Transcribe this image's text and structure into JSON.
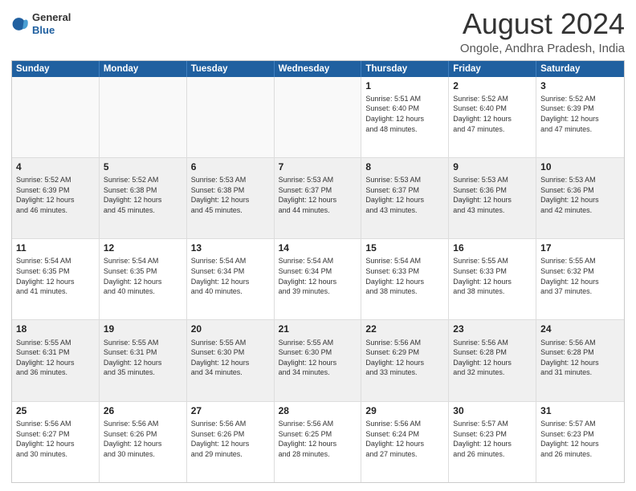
{
  "header": {
    "logo_general": "General",
    "logo_blue": "Blue",
    "month": "August 2024",
    "location": "Ongole, Andhra Pradesh, India"
  },
  "weekdays": [
    "Sunday",
    "Monday",
    "Tuesday",
    "Wednesday",
    "Thursday",
    "Friday",
    "Saturday"
  ],
  "rows": [
    [
      {
        "day": "",
        "info": "",
        "empty": true
      },
      {
        "day": "",
        "info": "",
        "empty": true
      },
      {
        "day": "",
        "info": "",
        "empty": true
      },
      {
        "day": "",
        "info": "",
        "empty": true
      },
      {
        "day": "1",
        "info": "Sunrise: 5:51 AM\nSunset: 6:40 PM\nDaylight: 12 hours\nand 48 minutes.",
        "empty": false
      },
      {
        "day": "2",
        "info": "Sunrise: 5:52 AM\nSunset: 6:40 PM\nDaylight: 12 hours\nand 47 minutes.",
        "empty": false
      },
      {
        "day": "3",
        "info": "Sunrise: 5:52 AM\nSunset: 6:39 PM\nDaylight: 12 hours\nand 47 minutes.",
        "empty": false
      }
    ],
    [
      {
        "day": "4",
        "info": "Sunrise: 5:52 AM\nSunset: 6:39 PM\nDaylight: 12 hours\nand 46 minutes.",
        "empty": false
      },
      {
        "day": "5",
        "info": "Sunrise: 5:52 AM\nSunset: 6:38 PM\nDaylight: 12 hours\nand 45 minutes.",
        "empty": false
      },
      {
        "day": "6",
        "info": "Sunrise: 5:53 AM\nSunset: 6:38 PM\nDaylight: 12 hours\nand 45 minutes.",
        "empty": false
      },
      {
        "day": "7",
        "info": "Sunrise: 5:53 AM\nSunset: 6:37 PM\nDaylight: 12 hours\nand 44 minutes.",
        "empty": false
      },
      {
        "day": "8",
        "info": "Sunrise: 5:53 AM\nSunset: 6:37 PM\nDaylight: 12 hours\nand 43 minutes.",
        "empty": false
      },
      {
        "day": "9",
        "info": "Sunrise: 5:53 AM\nSunset: 6:36 PM\nDaylight: 12 hours\nand 43 minutes.",
        "empty": false
      },
      {
        "day": "10",
        "info": "Sunrise: 5:53 AM\nSunset: 6:36 PM\nDaylight: 12 hours\nand 42 minutes.",
        "empty": false
      }
    ],
    [
      {
        "day": "11",
        "info": "Sunrise: 5:54 AM\nSunset: 6:35 PM\nDaylight: 12 hours\nand 41 minutes.",
        "empty": false
      },
      {
        "day": "12",
        "info": "Sunrise: 5:54 AM\nSunset: 6:35 PM\nDaylight: 12 hours\nand 40 minutes.",
        "empty": false
      },
      {
        "day": "13",
        "info": "Sunrise: 5:54 AM\nSunset: 6:34 PM\nDaylight: 12 hours\nand 40 minutes.",
        "empty": false
      },
      {
        "day": "14",
        "info": "Sunrise: 5:54 AM\nSunset: 6:34 PM\nDaylight: 12 hours\nand 39 minutes.",
        "empty": false
      },
      {
        "day": "15",
        "info": "Sunrise: 5:54 AM\nSunset: 6:33 PM\nDaylight: 12 hours\nand 38 minutes.",
        "empty": false
      },
      {
        "day": "16",
        "info": "Sunrise: 5:55 AM\nSunset: 6:33 PM\nDaylight: 12 hours\nand 38 minutes.",
        "empty": false
      },
      {
        "day": "17",
        "info": "Sunrise: 5:55 AM\nSunset: 6:32 PM\nDaylight: 12 hours\nand 37 minutes.",
        "empty": false
      }
    ],
    [
      {
        "day": "18",
        "info": "Sunrise: 5:55 AM\nSunset: 6:31 PM\nDaylight: 12 hours\nand 36 minutes.",
        "empty": false
      },
      {
        "day": "19",
        "info": "Sunrise: 5:55 AM\nSunset: 6:31 PM\nDaylight: 12 hours\nand 35 minutes.",
        "empty": false
      },
      {
        "day": "20",
        "info": "Sunrise: 5:55 AM\nSunset: 6:30 PM\nDaylight: 12 hours\nand 34 minutes.",
        "empty": false
      },
      {
        "day": "21",
        "info": "Sunrise: 5:55 AM\nSunset: 6:30 PM\nDaylight: 12 hours\nand 34 minutes.",
        "empty": false
      },
      {
        "day": "22",
        "info": "Sunrise: 5:56 AM\nSunset: 6:29 PM\nDaylight: 12 hours\nand 33 minutes.",
        "empty": false
      },
      {
        "day": "23",
        "info": "Sunrise: 5:56 AM\nSunset: 6:28 PM\nDaylight: 12 hours\nand 32 minutes.",
        "empty": false
      },
      {
        "day": "24",
        "info": "Sunrise: 5:56 AM\nSunset: 6:28 PM\nDaylight: 12 hours\nand 31 minutes.",
        "empty": false
      }
    ],
    [
      {
        "day": "25",
        "info": "Sunrise: 5:56 AM\nSunset: 6:27 PM\nDaylight: 12 hours\nand 30 minutes.",
        "empty": false
      },
      {
        "day": "26",
        "info": "Sunrise: 5:56 AM\nSunset: 6:26 PM\nDaylight: 12 hours\nand 30 minutes.",
        "empty": false
      },
      {
        "day": "27",
        "info": "Sunrise: 5:56 AM\nSunset: 6:26 PM\nDaylight: 12 hours\nand 29 minutes.",
        "empty": false
      },
      {
        "day": "28",
        "info": "Sunrise: 5:56 AM\nSunset: 6:25 PM\nDaylight: 12 hours\nand 28 minutes.",
        "empty": false
      },
      {
        "day": "29",
        "info": "Sunrise: 5:56 AM\nSunset: 6:24 PM\nDaylight: 12 hours\nand 27 minutes.",
        "empty": false
      },
      {
        "day": "30",
        "info": "Sunrise: 5:57 AM\nSunset: 6:23 PM\nDaylight: 12 hours\nand 26 minutes.",
        "empty": false
      },
      {
        "day": "31",
        "info": "Sunrise: 5:57 AM\nSunset: 6:23 PM\nDaylight: 12 hours\nand 26 minutes.",
        "empty": false
      }
    ]
  ]
}
